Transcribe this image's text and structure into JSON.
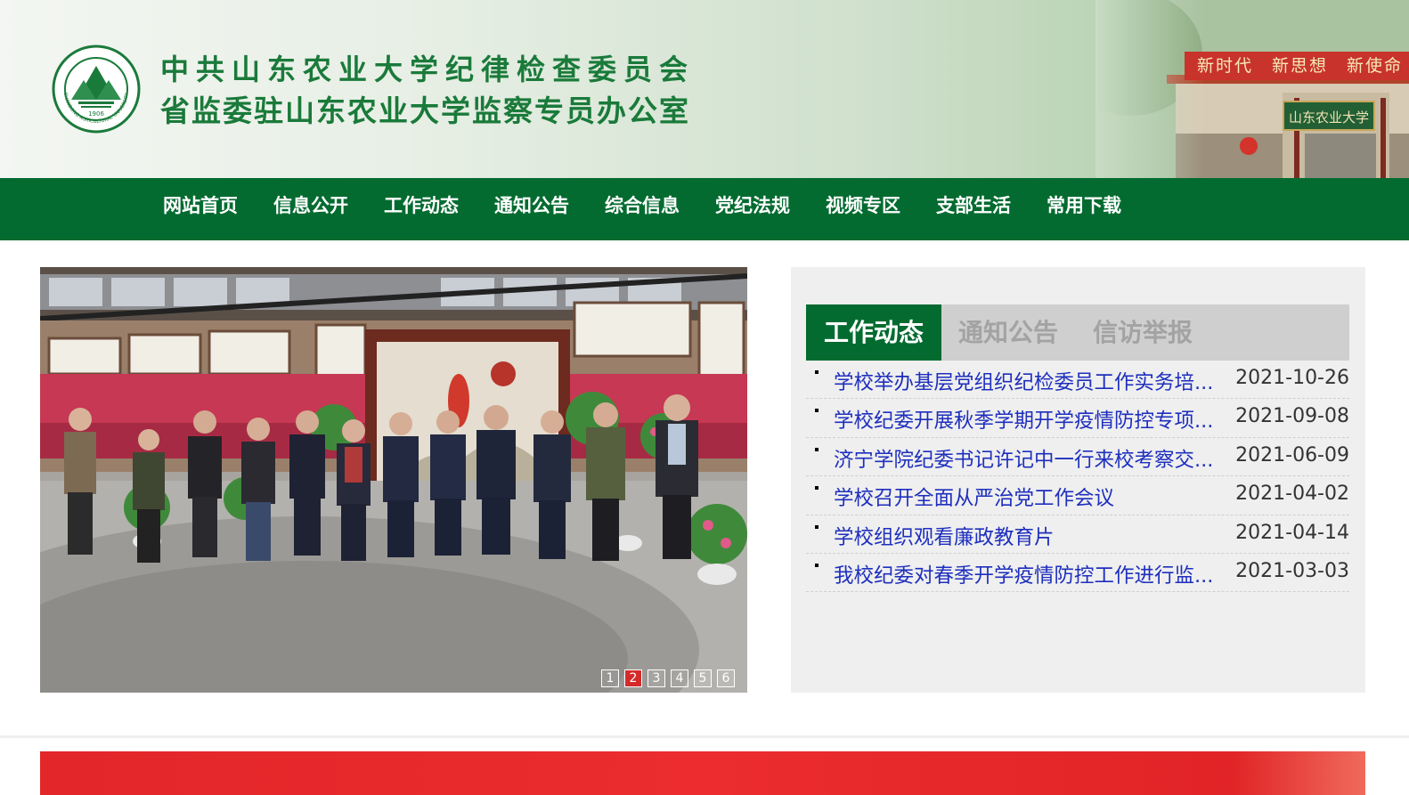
{
  "header": {
    "title_line1": "中共山东农业大学纪律检查委员会",
    "title_line2": "省监委驻山东农业大学监察专员办公室",
    "logo": {
      "icon": "university-seal-icon",
      "year": "1906",
      "ring_text": "SHANDONG AGRICULTURAL UNIVERSITY"
    },
    "banner_slogan": "新时代　新思想　新使命",
    "gate_sign": "山东农业大学"
  },
  "nav": {
    "items": [
      {
        "label": "网站首页"
      },
      {
        "label": "信息公开"
      },
      {
        "label": "工作动态"
      },
      {
        "label": "通知公告"
      },
      {
        "label": "综合信息"
      },
      {
        "label": "党纪法规"
      },
      {
        "label": "视频专区"
      },
      {
        "label": "支部生活"
      },
      {
        "label": "常用下载"
      }
    ]
  },
  "slideshow": {
    "pages": [
      "1",
      "2",
      "3",
      "4",
      "5",
      "6"
    ],
    "active_page": "2"
  },
  "news_panel": {
    "tabs": [
      {
        "label": "工作动态",
        "active": true
      },
      {
        "label": "通知公告",
        "active": false
      },
      {
        "label": "信访举报",
        "active": false
      }
    ],
    "items": [
      {
        "title": "学校举办基层党组织纪检委员工作实务培...",
        "date": "2021-10-26"
      },
      {
        "title": "学校纪委开展秋季学期开学疫情防控专项...",
        "date": "2021-09-08"
      },
      {
        "title": "济宁学院纪委书记许记中一行来校考察交...",
        "date": "2021-06-09"
      },
      {
        "title": "学校召开全面从严治党工作会议",
        "date": "2021-04-02"
      },
      {
        "title": "学校组织观看廉政教育片",
        "date": "2021-04-14"
      },
      {
        "title": "我校纪委对春季开学疫情防控工作进行监...",
        "date": "2021-03-03"
      }
    ]
  },
  "colors": {
    "brand_green": "#036b30",
    "title_green": "#1a7a3a",
    "link_blue": "#1e2fbe",
    "pager_active": "#d52a2a",
    "bottom_band": "#e2262a"
  }
}
